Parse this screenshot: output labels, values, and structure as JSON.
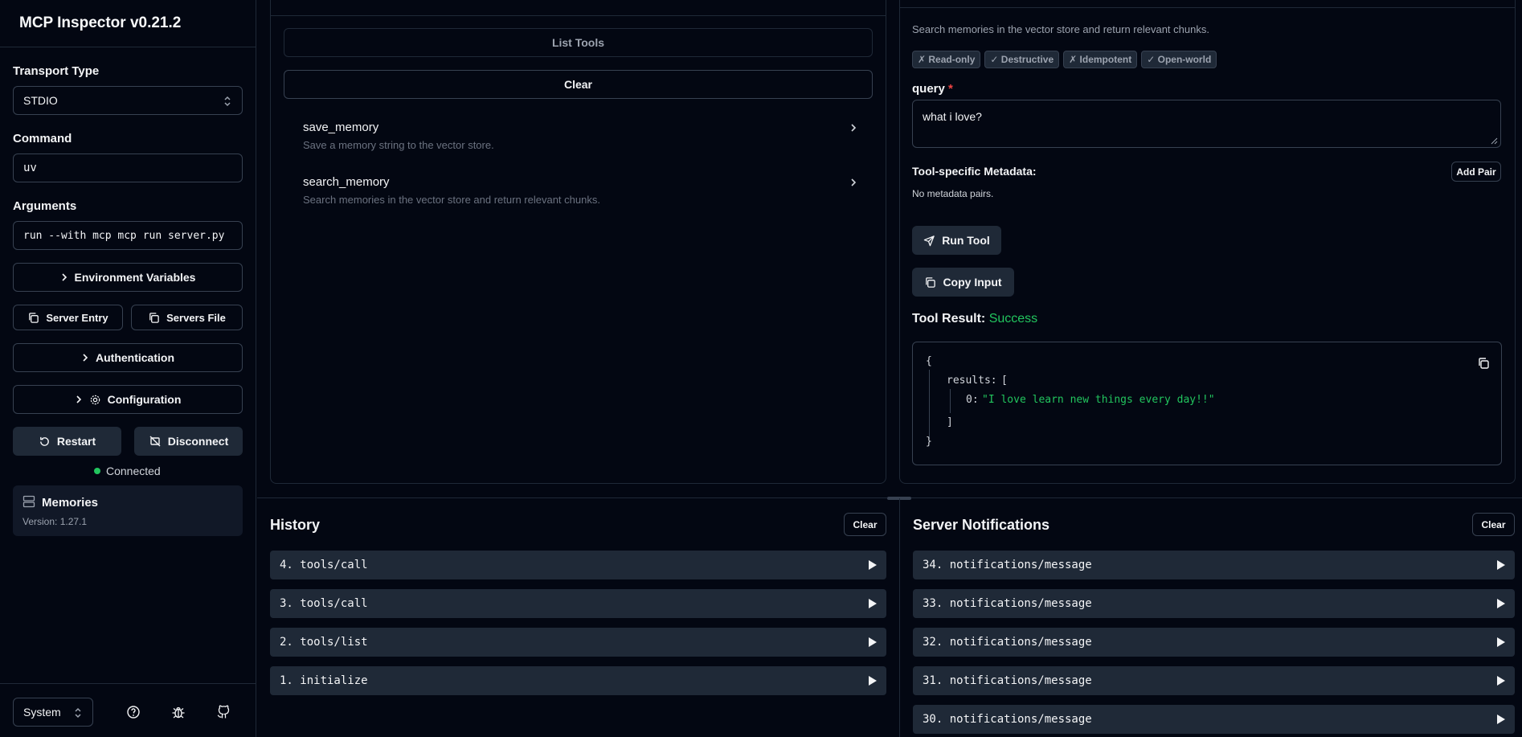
{
  "app": {
    "title": "MCP Inspector v0.21.2"
  },
  "sidebar": {
    "transport_label": "Transport Type",
    "transport_value": "STDIO",
    "command_label": "Command",
    "command_value": "uv",
    "arguments_label": "Arguments",
    "arguments_value": "run --with mcp mcp run server.py",
    "env_vars": "Environment Variables",
    "server_entry": "Server Entry",
    "servers_file": "Servers File",
    "authentication": "Authentication",
    "configuration": "Configuration",
    "restart": "Restart",
    "disconnect": "Disconnect",
    "status": "Connected",
    "status_color": "#22c55e",
    "server_name": "Memories",
    "server_version": "Version: 1.27.1",
    "theme": "System"
  },
  "tools": {
    "list_button": "List Tools",
    "clear_button": "Clear",
    "items": [
      {
        "name": "save_memory",
        "description": "Save a memory string to the vector store."
      },
      {
        "name": "search_memory",
        "description": "Search memories in the vector store and return relevant chunks."
      }
    ]
  },
  "detail": {
    "description": "Search memories in the vector store and return relevant chunks.",
    "badges": [
      "✗ Read-only",
      "✓ Destructive",
      "✗ Idempotent",
      "✓ Open-world"
    ],
    "query_label": "query",
    "required_mark": "*",
    "query_value": "what i love?",
    "metadata_label": "Tool-specific Metadata:",
    "add_pair": "Add Pair",
    "no_metadata": "No metadata pairs.",
    "run_tool": "Run Tool",
    "copy_input": "Copy Input",
    "result_label": "Tool Result:",
    "result_status": "Success",
    "success_color": "#22c55e",
    "json": {
      "open_brace": "{",
      "results_key": "results:",
      "open_bracket": "[",
      "index": "0:",
      "value": "\"I love learn new things every day!!\"",
      "close_bracket": "]",
      "close_brace": "}"
    }
  },
  "history": {
    "title": "History",
    "clear": "Clear",
    "items": [
      "4. tools/call",
      "3. tools/call",
      "2. tools/list",
      "1. initialize"
    ]
  },
  "notifications": {
    "title": "Server Notifications",
    "clear": "Clear",
    "items": [
      "34. notifications/message",
      "33. notifications/message",
      "32. notifications/message",
      "31. notifications/message",
      "30. notifications/message"
    ]
  }
}
